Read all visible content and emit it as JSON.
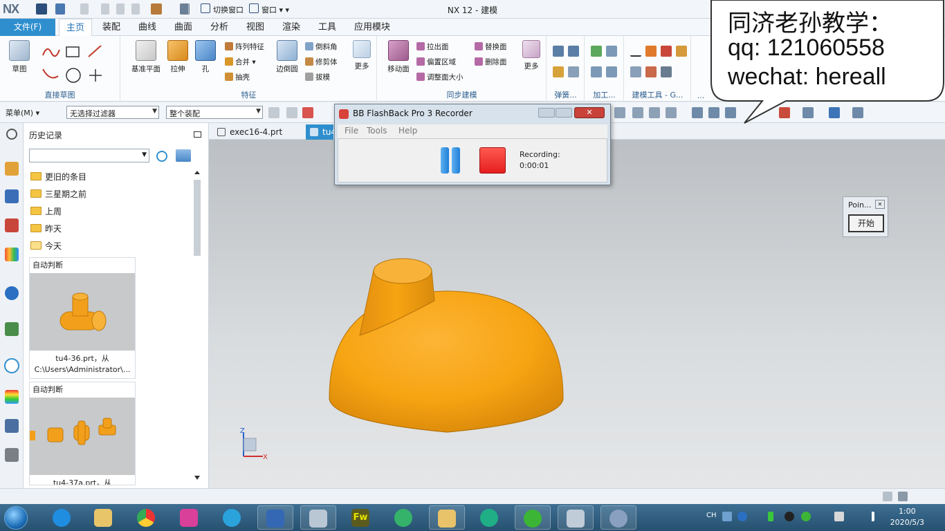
{
  "titlebar": {
    "logo": "NX",
    "title": "NX 12 - 建模",
    "switch_window": "切换窗口",
    "window_menu": "窗口 ▾ ▾"
  },
  "ribbon_tabs": {
    "file": "文件(F)",
    "tabs": [
      "主页",
      "装配",
      "曲线",
      "曲面",
      "分析",
      "视图",
      "渲染",
      "工具",
      "应用模块"
    ],
    "active": "主页"
  },
  "ribbon": {
    "sketch": {
      "label": "草图",
      "group": "直接草图"
    },
    "feature_group": "特征",
    "datum_plane": "基准平面",
    "extrude": "拉伸",
    "hole": "孔",
    "pattern_feature": "阵列特征",
    "unite": "合并",
    "shell": "抽壳",
    "edge_blend": "边倒圆",
    "chamfer": "倒斜角",
    "trim_body": "修剪体",
    "draft": "拔模",
    "more1": "更多",
    "sync_group": "同步建模",
    "move_face": "移动面",
    "pull_face": "拉出面",
    "offset_region": "偏置区域",
    "resize_face": "调整面大小",
    "replace_face": "替换面",
    "delete_face": "删除面",
    "more2": "更多",
    "spring_group": "弹簧...",
    "machining_group": "加工...",
    "modeling_tools_group": "建模工具 - G...",
    "ellipsis_group": "..."
  },
  "toolbar2": {
    "menu": "菜单(M) ▾",
    "filter": "无选择过滤器",
    "assembly_scope": "整个装配"
  },
  "history": {
    "title": "历史记录",
    "folders": [
      "更旧的条目",
      "三星期之前",
      "上周",
      "昨天",
      "今天"
    ],
    "cards": [
      {
        "head": "自动判断",
        "caption1": "tu4-36.prt，从",
        "caption2": "C:\\Users\\Administrator\\..."
      },
      {
        "head": "自动判断",
        "caption1": "tu4-37a.prt，从"
      }
    ]
  },
  "doc_tabs": {
    "tab1": "exec16-4.prt",
    "tab2": "tu4"
  },
  "recorder": {
    "title": "BB FlashBack Pro 3 Recorder",
    "menu": [
      "File",
      "Tools",
      "Help"
    ],
    "status_label": "Recording:",
    "elapsed": "0:00:01"
  },
  "point_dialog": {
    "title": "Poin...",
    "start": "开始"
  },
  "triad": {
    "z": "Z",
    "x": "X"
  },
  "watermark": {
    "line1": "同济老孙教学：",
    "line2": "qq: 121060558",
    "line3": "wechat:  hereall"
  },
  "taskbar": {
    "ime": "CH",
    "time": "1:00",
    "date": "2020/5/3"
  },
  "colors": {
    "accent": "#2f8fce",
    "part_orange": "#f6a412",
    "record_red": "#e41e1e",
    "pause_blue": "#1f7fd8"
  }
}
